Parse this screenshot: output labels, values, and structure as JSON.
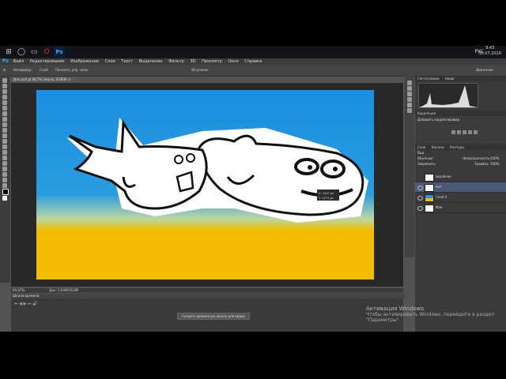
{
  "taskbar": {
    "clock_time": "9:43",
    "clock_date": "30.07.2019",
    "language": "РУС",
    "icons": [
      "start-icon",
      "cortana-icon",
      "task-view-icon",
      "opera-icon",
      "photoshop-icon"
    ]
  },
  "menu": {
    "logo": "Ps",
    "items": [
      "Файл",
      "Редактирование",
      "Изображение",
      "Слои",
      "Текст",
      "Выделение",
      "Фильтр",
      "3D",
      "Просмотр",
      "Окно",
      "Справка"
    ]
  },
  "options": {
    "tool_mode": "Автовыбор:",
    "mode_value": "Слой",
    "show_controls": "Показать упр. элем.",
    "mode_3d": "3D-режим:",
    "workspace": "Движение"
  },
  "document": {
    "tab_title": "фон.psd @ 66,7% (акула, RGB/8) ×",
    "zoom": "66,67%",
    "doc_size": "Док: 5,93M/56,8M"
  },
  "timeline": {
    "title": "Шкала времени",
    "create_button": "Создать временную шкалу для видео"
  },
  "panels": {
    "tabs_top": [
      "Гистограмма",
      "Навиг"
    ],
    "tabs_adj": [
      "Коррекция"
    ],
    "adj_title": "Добавить корректировку",
    "tabs_layers": [
      "Слои",
      "Каналы",
      "Контуры"
    ],
    "kind_label": "Вид",
    "blend_mode": "Обычные",
    "opacity_label": "Непрозрачность:",
    "opacity_value": "100%",
    "lock_label": "Закрепить:",
    "fill_label": "Заливка:",
    "fill_value": "100%",
    "layers": [
      {
        "name": "акулёнок",
        "selected": false
      },
      {
        "name": "кит",
        "selected": true
      },
      {
        "name": "Слой 0",
        "selected": false
      },
      {
        "name": "Фон",
        "selected": false
      }
    ]
  },
  "cursor_tooltip": {
    "line1": "X: 1347 px",
    "line2": "Y: 1271 px"
  },
  "windows_activation": {
    "title": "Активация Windows",
    "text": "Чтобы активировать Windows, перейдите в раздел \"Параметры\"."
  },
  "colors": {
    "sky": "#1e96e0",
    "sand": "#f2bd00",
    "ps_blue": "#31a8ff"
  }
}
